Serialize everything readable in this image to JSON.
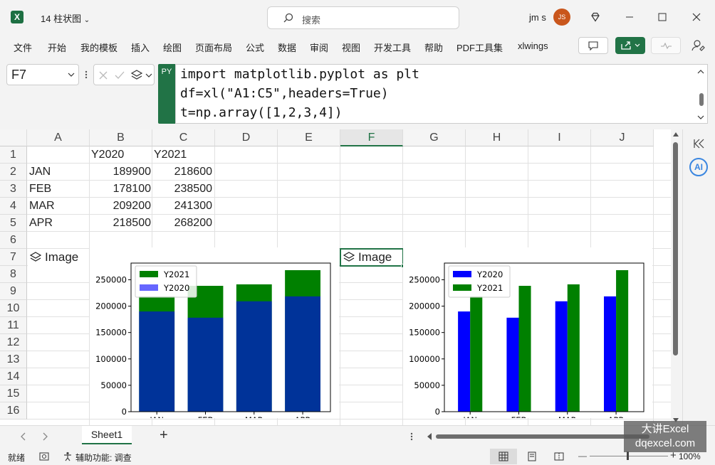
{
  "window": {
    "app_icon": "X",
    "title": "14 柱状图",
    "search_placeholder": "搜索",
    "user_name": "jm s",
    "avatar_initials": "JS"
  },
  "ribbon": {
    "menu": [
      "文件",
      "开始",
      "我的模板",
      "插入",
      "绘图",
      "页面布局",
      "公式",
      "数据",
      "审阅",
      "视图",
      "开发工具",
      "帮助",
      "PDF工具集",
      "xlwings"
    ]
  },
  "formula_bar": {
    "name_box": "F7",
    "py_badge": "PY",
    "code": [
      "import matplotlib.pyplot as plt",
      "df=xl(\"A1:C5\",headers=True)",
      "t=np.array([1,2,3,4])"
    ]
  },
  "sheet": {
    "columns": [
      "A",
      "B",
      "C",
      "D",
      "E",
      "F",
      "G",
      "H",
      "I",
      "J"
    ],
    "rows": [
      "1",
      "2",
      "3",
      "4",
      "5",
      "6",
      "7",
      "8",
      "9",
      "10",
      "11",
      "12",
      "13",
      "14",
      "15",
      "16"
    ],
    "headers": [
      "",
      "Y2020",
      "Y2021"
    ],
    "data": [
      [
        "JAN",
        "189900",
        "218600"
      ],
      [
        "FEB",
        "178100",
        "238500"
      ],
      [
        "MAR",
        "209200",
        "241300"
      ],
      [
        "APR",
        "218500",
        "268200"
      ]
    ],
    "image_label": "Image"
  },
  "sidepane": {
    "ai_label": "AI"
  },
  "tabs": {
    "sheet_name": "Sheet1",
    "add": "+"
  },
  "status": {
    "ready": "就绪",
    "accessibility": "辅助功能: 调查",
    "zoom": "100%",
    "minus": "—",
    "plus": "+"
  },
  "watermark": {
    "line1": "大讲Excel",
    "line2": "dqexcel.com"
  },
  "chart_data": [
    {
      "type": "bar",
      "categories": [
        "JAN",
        "FEB",
        "MAR",
        "APR"
      ],
      "series": [
        {
          "name": "Y2021",
          "values": [
            218600,
            238500,
            241300,
            268200
          ],
          "color": "#008000"
        },
        {
          "name": "Y2020",
          "values": [
            189900,
            178100,
            209200,
            218500
          ],
          "color": "#0000ff",
          "opacity": 0.6
        }
      ],
      "layout": "overlaid",
      "yticks": [
        0,
        50000,
        100000,
        150000,
        200000,
        250000
      ],
      "ylim": [
        0,
        281610
      ],
      "legend_loc": "upper left"
    },
    {
      "type": "bar",
      "categories": [
        "JAN",
        "FEB",
        "MAR",
        "APR"
      ],
      "series": [
        {
          "name": "Y2020",
          "values": [
            189900,
            178100,
            209200,
            218500
          ],
          "color": "#0000ff"
        },
        {
          "name": "Y2021",
          "values": [
            218600,
            238500,
            241300,
            268200
          ],
          "color": "#008000"
        }
      ],
      "layout": "grouped",
      "yticks": [
        0,
        50000,
        100000,
        150000,
        200000,
        250000
      ],
      "ylim": [
        0,
        281610
      ],
      "legend_loc": "upper left"
    }
  ]
}
